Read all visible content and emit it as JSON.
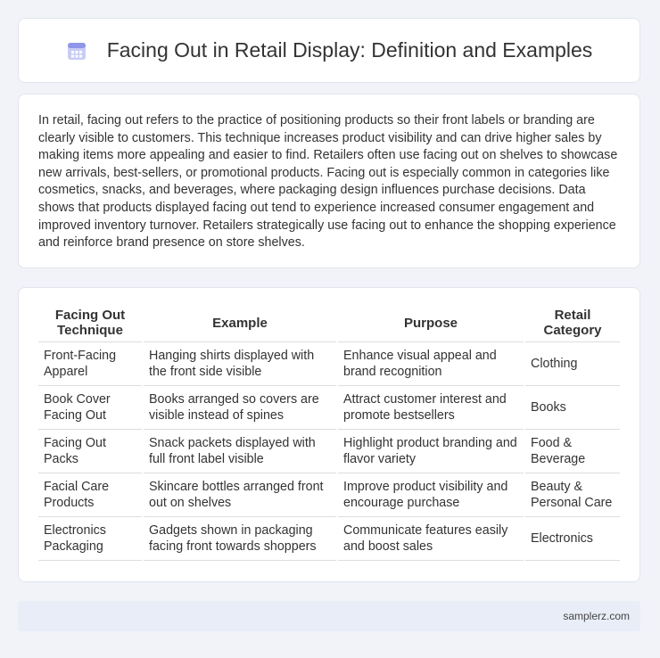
{
  "header": {
    "title": "Facing Out in Retail Display: Definition and Examples",
    "icon": "calendar-icon"
  },
  "intro": {
    "text": "In retail, facing out refers to the practice of positioning products so their front labels or branding are clearly visible to customers. This technique increases product visibility and can drive higher sales by making items more appealing and easier to find. Retailers often use facing out on shelves to showcase new arrivals, best-sellers, or promotional products. Facing out is especially common in categories like cosmetics, snacks, and beverages, where packaging design influences purchase decisions. Data shows that products displayed facing out tend to experience increased consumer engagement and improved inventory turnover. Retailers strategically use facing out to enhance the shopping experience and reinforce brand presence on store shelves."
  },
  "table": {
    "headers": [
      "Facing Out Technique",
      "Example",
      "Purpose",
      "Retail Category"
    ],
    "rows": [
      [
        "Front-Facing Apparel",
        "Hanging shirts displayed with the front side visible",
        "Enhance visual appeal and brand recognition",
        "Clothing"
      ],
      [
        "Book Cover Facing Out",
        "Books arranged so covers are visible instead of spines",
        "Attract customer interest and promote bestsellers",
        "Books"
      ],
      [
        "Facing Out Packs",
        "Snack packets displayed with full front label visible",
        "Highlight product branding and flavor variety",
        "Food & Beverage"
      ],
      [
        "Facial Care Products",
        "Skincare bottles arranged front out on shelves",
        "Improve product visibility and encourage purchase",
        "Beauty & Personal Care"
      ],
      [
        "Electronics Packaging",
        "Gadgets shown in packaging facing front towards shoppers",
        "Communicate features easily and boost sales",
        "Electronics"
      ]
    ]
  },
  "footer": {
    "site": "samplerz.com"
  }
}
